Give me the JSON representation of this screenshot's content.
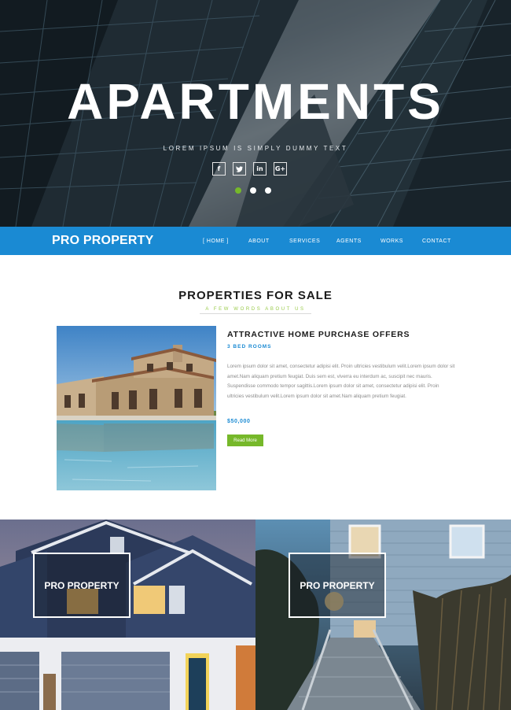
{
  "hero": {
    "title": "APARTMENTS",
    "subtitle": "LOREM IPSUM IS SIMPLY DUMMY TEXT",
    "socials": [
      {
        "icon": "facebook-icon",
        "glyph": "f"
      },
      {
        "icon": "twitter-icon",
        "glyph": "t"
      },
      {
        "icon": "linkedin-icon",
        "glyph": "in"
      },
      {
        "icon": "google-plus-icon",
        "glyph": "G+"
      }
    ],
    "slides": 3,
    "active_slide": 1
  },
  "nav": {
    "brand": "PRO PROPERTY",
    "items": [
      "[ HOME ]",
      "ABOUT",
      "SERVICES",
      "AGENTS",
      "WORKS",
      "CONTACT"
    ]
  },
  "section": {
    "title": "PROPERTIES FOR SALE",
    "subtitle": "A FEW WORDS ABOUT US"
  },
  "offer": {
    "title": "ATTRACTIVE HOME PURCHASE OFFERS",
    "rooms": "3 BED ROOMS",
    "description": "Lorem ipsum dolor sit amet, consectetur adipisi elit. Proin ultricies vestibulum velit.Lorem ipsum dolor sit amet.Nam aliquam pretium feugiat. Duis sem est, viverra eu interdum ac, suscipit nec mauris. Suspendisse commodo tempor sagittis.Lorem ipsum dolor sit amet, consectetur adipisi elit. Proin ultricies vestibulum velit.Lorem ipsum dolor sit amet.Nam aliquam pretium feugiat.",
    "price": "$50,000",
    "button": "Read More"
  },
  "panels": {
    "left_label": "PRO PROPERTY",
    "right_label": "PRO PROPERTY"
  },
  "colors": {
    "accent_blue": "#1a8ad3",
    "accent_green": "#76b82a"
  }
}
